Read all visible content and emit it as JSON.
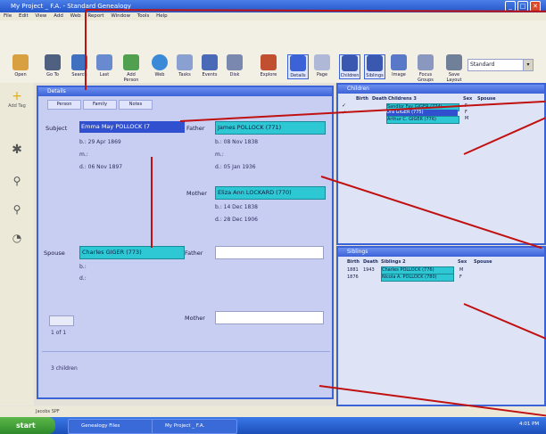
{
  "app": {
    "title": "My Project _ F.A. - Standard Genealogy",
    "menu": [
      "File",
      "Edit",
      "View",
      "Add",
      "Web",
      "Report",
      "Window",
      "Tools",
      "Help"
    ]
  },
  "toolbar": {
    "buttons": [
      "Open",
      "Go To",
      "Search",
      "Last",
      "Add Person",
      "Web",
      "Tasks",
      "Events",
      "Disk",
      "Explore",
      "Details",
      "Page",
      "Children",
      "Siblings",
      "Image",
      "Focus Groups",
      "Save Layout"
    ],
    "layout_select": "Standard"
  },
  "leftbar": {
    "items": [
      "Add Tag"
    ]
  },
  "details": {
    "title": "Details",
    "tabs": [
      "Person",
      "Family",
      "Notes"
    ],
    "subject_label": "Subject",
    "subject_name": "Emma May POLLOCK (7",
    "subject_birth": "b.: 29 Apr 1869",
    "subject_mid": "m.:",
    "subject_death": "d.: 06 Nov 1897",
    "father_label": "Father",
    "father_name": "James POLLOCK (771)",
    "father_birth": "b.: 08 Nov 1838",
    "father_mid": "m.:",
    "father_death": "d.: 05 Jan 1936",
    "mother_label": "Mother",
    "mother_name": "Eliza Ann LOCKARD (770)",
    "mother_birth": "b.: 14 Dec 1838",
    "mother_death": "d.: 28 Dec 1906",
    "spouse_label": "Spouse",
    "spouse_name": "Charles GIGER (773)",
    "spouse_birth": "b.:",
    "spouse_death": "d.:",
    "spouse_father_label": "Father",
    "spouse_mother_label": "Mother",
    "pager": "1 of 1",
    "children_count": "3 children"
  },
  "children": {
    "title": "Children",
    "columns": [
      "Birth",
      "Death",
      "Childrens 3",
      "Sex",
      "Spouse"
    ],
    "rows": [
      {
        "name": "Sandlor Fay GIGER (774)",
        "sex": "F"
      },
      {
        "name": "Ora GIGER (775)",
        "sex": "F"
      },
      {
        "name": "Arthur C. GIGER (776)",
        "sex": "M"
      }
    ]
  },
  "siblings": {
    "title": "Siblings",
    "columns": [
      "Birth",
      "Death",
      "Siblings 2",
      "Sex",
      "Spouse"
    ],
    "rows": [
      {
        "birth": "1881",
        "death": "1943",
        "name": "Charles POLLOCK (776)",
        "sex": "M"
      },
      {
        "birth": "1876",
        "death": "",
        "name": "Nicola A. POLLOCK (780)",
        "sex": "F"
      }
    ]
  },
  "status": {
    "text": "Jacobs SPF"
  },
  "taskbar": {
    "start": "start",
    "tasks": [
      "Genealogy Files",
      "My Project _ F.A."
    ],
    "clock": "4:01 PM"
  },
  "colors": {
    "accent": "#3c62d8",
    "highlight": "#2ec7d4",
    "arrow": "#c01010"
  }
}
